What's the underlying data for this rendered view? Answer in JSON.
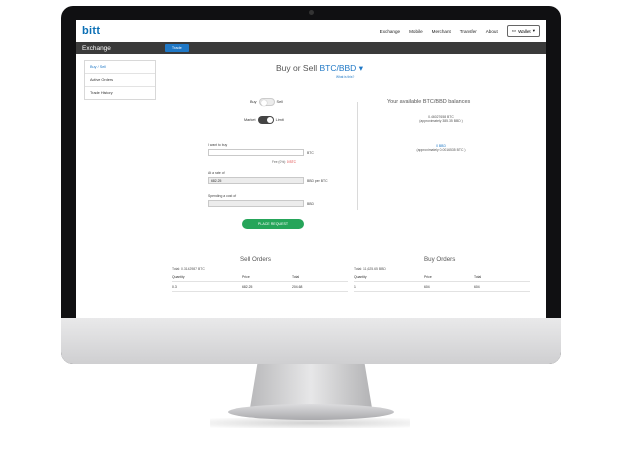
{
  "app": {
    "logo": "bitt",
    "nav": [
      "Exchange",
      "Mobile",
      "Merchant",
      "Transfer",
      "About"
    ],
    "wallet_label": "Wallet"
  },
  "subheader": {
    "title": "Exchange",
    "tab_label": "Trade"
  },
  "sidebar": {
    "items": [
      {
        "label": "Buy / Sell",
        "active": true
      },
      {
        "label": "Active Orders",
        "active": false
      },
      {
        "label": "Trade History",
        "active": false
      }
    ]
  },
  "main": {
    "title_prefix": "Buy or Sell",
    "pair": "BTC/BBD",
    "what_is_this": "What is this?",
    "toggle_buy": "Buy",
    "toggle_sell": "Sell",
    "toggle_market": "Market",
    "toggle_limit": "Limit",
    "want_label": "I want to buy",
    "want_unit": "BTC",
    "fee_label": "Fee (0%):",
    "fee_value": "0 BTC",
    "rate_label": "At a rate of",
    "rate_value": "682.25",
    "rate_unit": "BBD per BTC",
    "cost_label": "Spending a cost of",
    "cost_unit": "BBD",
    "place_request": "PLACE REQUEST"
  },
  "balances": {
    "title": "Your available BTC/BBD balances",
    "btc_value": "0.46027658 BTC",
    "btc_approx": "(approximately 385.35 BBD )",
    "bbd_value": "0 BBD",
    "bbd_approx": "(approximately 0.0016535 BTC )"
  },
  "sell_orders": {
    "title": "Sell Orders",
    "total": "Total: 0.3142987 BTC",
    "columns": [
      "Quantity",
      "Price",
      "Total"
    ],
    "rows": [
      [
        "0.3",
        "682.25",
        "204.68"
      ]
    ]
  },
  "buy_orders": {
    "title": "Buy Orders",
    "total": "Total: 11,625.65 BBD",
    "columns": [
      "Quantity",
      "Price",
      "Total"
    ],
    "rows": [
      [
        "1",
        "604",
        "604"
      ]
    ]
  }
}
